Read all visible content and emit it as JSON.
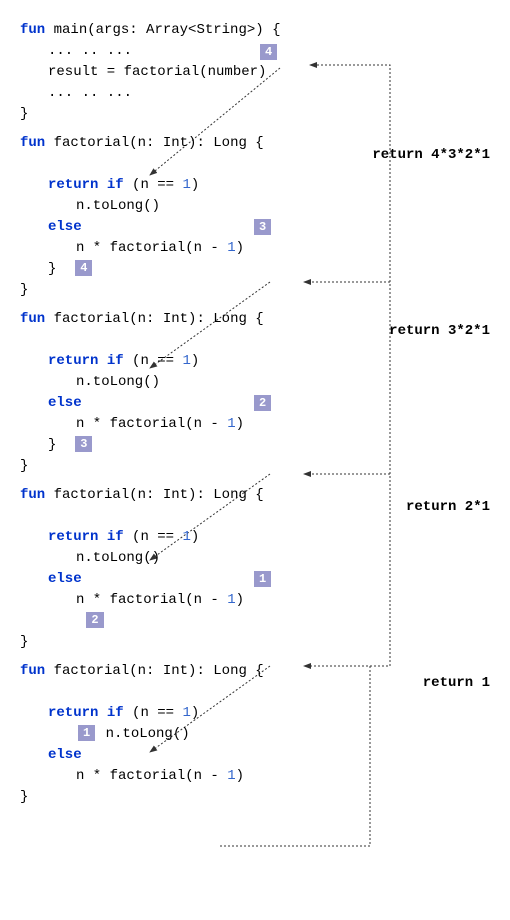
{
  "main": {
    "sig_fun": "fun",
    "sig_name": "main",
    "sig_args_open": "(args: Array<String>) {",
    "ellipsis1": "... .. ...",
    "result_line": "result = factorial(number)",
    "ellipsis2": "... .. ...",
    "close": "}"
  },
  "step_main": "4",
  "blocks": [
    {
      "step_call": "3",
      "step_return": "4",
      "return_text": "return 4*3*2*1"
    },
    {
      "step_call": "2",
      "step_return": "3",
      "return_text": "return 3*2*1"
    },
    {
      "step_call": "1",
      "step_return": "2",
      "return_text": "return 2*1"
    },
    {
      "step_call": "",
      "step_return": "1",
      "return_text": "return 1"
    }
  ],
  "fn": {
    "sig_fun": "fun",
    "sig_name": "factorial",
    "sig_rest": "(n: Int): Long {",
    "return_kw": "return",
    "if_kw": "if",
    "cond": " (n == ",
    "one": "1",
    "cond_close": ")",
    "tolong": "n.toLong()",
    "else_kw": "else",
    "else_body_pre": "n * factorial(n - ",
    "else_body_post": ")",
    "inner_close": "}",
    "close": "}"
  }
}
